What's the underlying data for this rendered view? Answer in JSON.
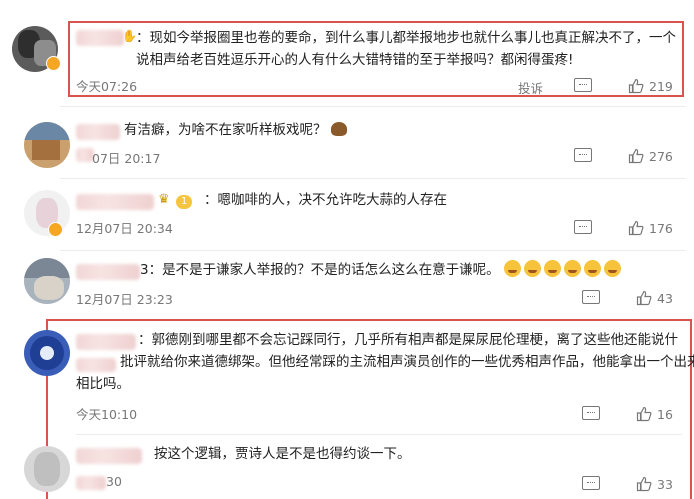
{
  "comments": [
    {
      "text": "：现如今举报圈里也卷的要命，到什么事儿都举报地步也就什么事儿也真正解决不了，一个说相声给老百姓逗乐开心的人有什么大错特错的至于举报吗？都闲得蛋疼!",
      "time": "今天07:26",
      "report_label": "投诉",
      "likes": "219"
    },
    {
      "text": "有洁癖，为啥不在家听样板戏呢？",
      "time": "07日 20:17",
      "likes": "276"
    },
    {
      "badge": "1",
      "text": "：嗯咖啡的人，决不允许吃大蒜的人存在",
      "time": "12月07日 20:34",
      "likes": "176"
    },
    {
      "name_suffix": "3",
      "text": "：是不是于谦家人举报的？不是的话怎么这么在意于谦呢。",
      "time": "12月07日 23:23",
      "likes": "43"
    },
    {
      "text_line1": "：郭德刚到哪里都不会忘记踩同行，几乎所有相声都是屎尿屁伦理梗，离了这些他还能说什",
      "text_line2": "批评就给你来道德绑架。但他经常踩的主流相声演员创作的一些优秀相声作品，他能拿出一个出来",
      "text_line3": "相比吗。",
      "time": "今天10:10",
      "likes": "16"
    },
    {
      "text": "按这个逻辑，贾诗人是不是也得约谈一下。",
      "time": "30",
      "likes": "33"
    }
  ],
  "colors": {
    "highlight_box": "#d9534f",
    "meta_text": "#777777"
  }
}
